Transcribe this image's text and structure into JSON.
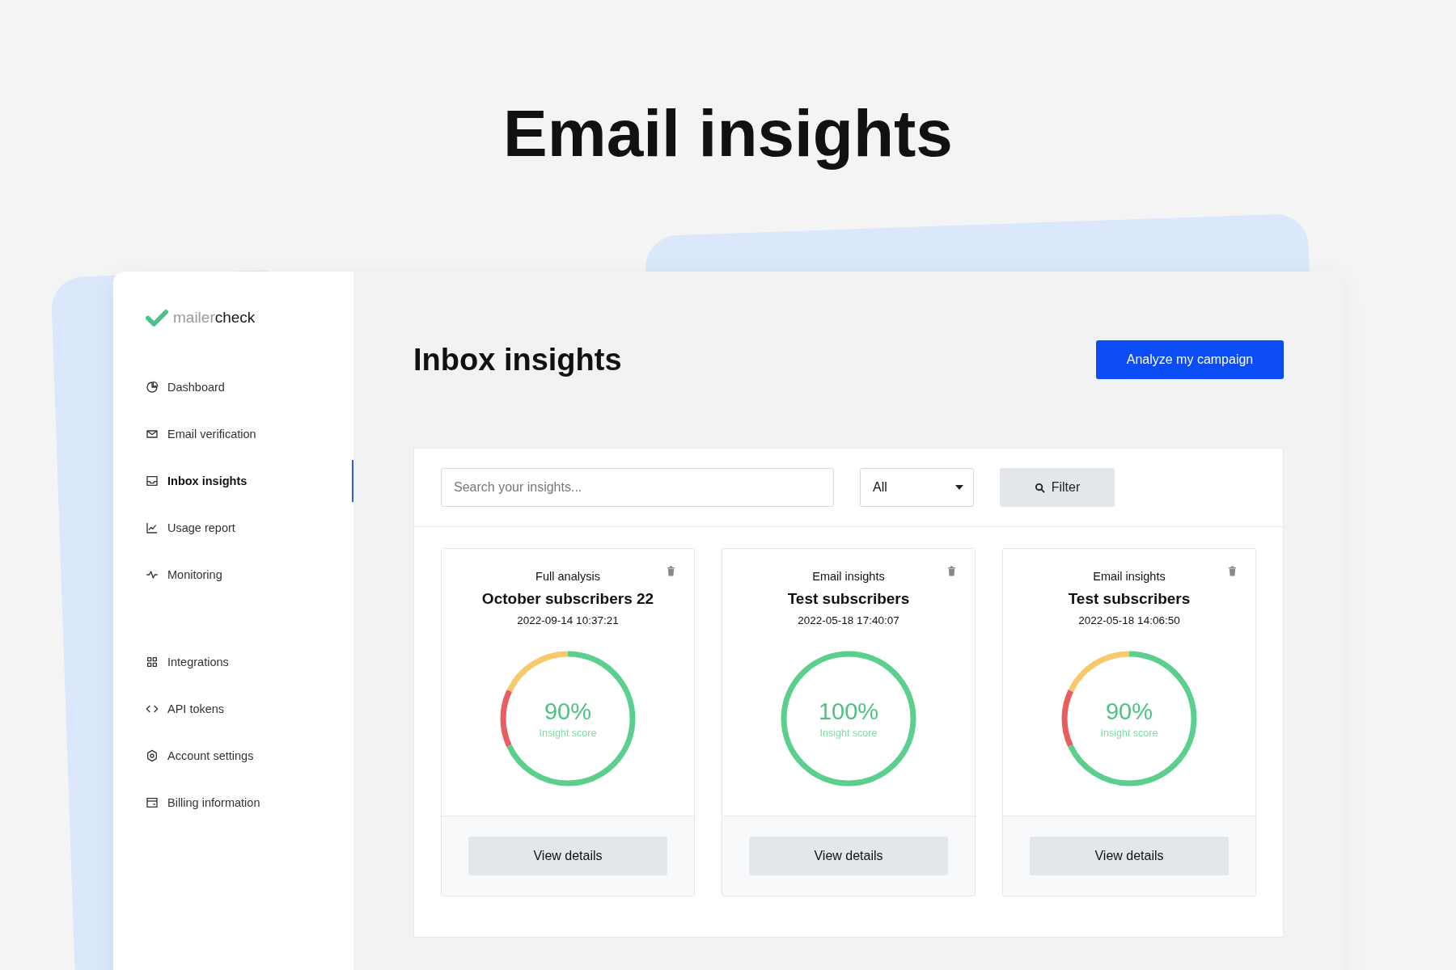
{
  "headline": "Email insights",
  "logo": {
    "light": "mailer",
    "dark": "check"
  },
  "nav_groups": [
    {
      "items": [
        {
          "label": "Dashboard",
          "selected": false
        },
        {
          "label": "Email verification",
          "selected": false
        },
        {
          "label": "Inbox insights",
          "selected": true
        },
        {
          "label": "Usage report",
          "selected": false
        },
        {
          "label": "Monitoring",
          "selected": false
        }
      ]
    },
    {
      "items": [
        {
          "label": "Integrations",
          "selected": false
        },
        {
          "label": "API tokens",
          "selected": false
        },
        {
          "label": "Account settings",
          "selected": false
        },
        {
          "label": "Billing information",
          "selected": false
        }
      ]
    }
  ],
  "page_title": "Inbox insights",
  "primary_button": "Analyze my campaign",
  "search": {
    "placeholder": "Search your insights..."
  },
  "type_select": {
    "value": "All"
  },
  "filter_button": "Filter",
  "cards": [
    {
      "type": "Full analysis",
      "name": "October subscribers 22",
      "date": "2022-09-14 10:37:21",
      "score": "90%",
      "score_label": "Insight score",
      "segments": [
        {
          "color": "#5ccf8e",
          "level": 0.68
        },
        {
          "color": "#e85d5d",
          "level": 0.14
        },
        {
          "color": "#f7c96b",
          "level": 0.18
        }
      ],
      "button": "View details"
    },
    {
      "type": "Email insights",
      "name": "Test subscribers",
      "date": "2022-05-18 17:40:07",
      "score": "100%",
      "score_label": "Insight score",
      "segments": [
        {
          "color": "#5ccf8e",
          "level": 1
        }
      ],
      "button": "View details"
    },
    {
      "type": "Email insights",
      "name": "Test subscribers",
      "date": "2022-05-18 14:06:50",
      "score": "90%",
      "score_label": "Insight score",
      "segments": [
        {
          "color": "#5ccf8e",
          "level": 0.68
        },
        {
          "color": "#e85d5d",
          "level": 0.14
        },
        {
          "color": "#f7c96b",
          "level": 0.18
        }
      ],
      "button": "View details"
    }
  ]
}
